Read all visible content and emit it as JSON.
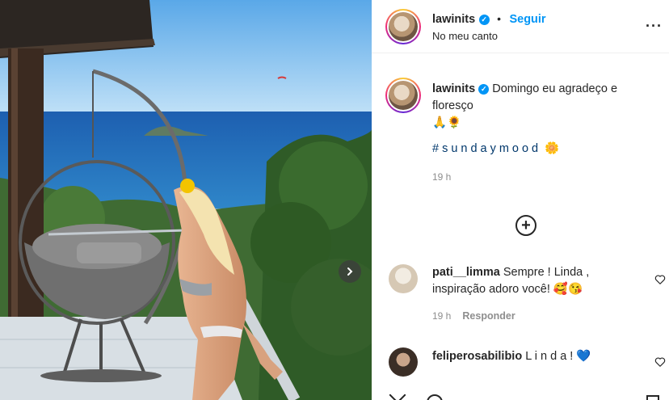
{
  "post": {
    "username": "lawinits",
    "location": "No meu canto",
    "follow_label": "Seguir",
    "separator": "•",
    "more_icon": "more-options-icon"
  },
  "caption": {
    "username": "lawinits",
    "text": "Domingo eu agradeço e floresço",
    "emojis": "🙏🌻",
    "hashtag": "#sundaymood",
    "hashtag_emoji": "🌼",
    "time": "19 h"
  },
  "load_more": "+",
  "comments": [
    {
      "username": "pati__limma",
      "text": "Sempre ! Linda , inspiração adoro você! 🥰😘",
      "time": "19 h",
      "reply_label": "Responder"
    },
    {
      "username": "feliperosabilibio",
      "text": "L i n d a ! 💙"
    }
  ],
  "colors": {
    "accent": "#0095f6",
    "hashtag": "#00376b",
    "muted": "#8e8e8e"
  }
}
